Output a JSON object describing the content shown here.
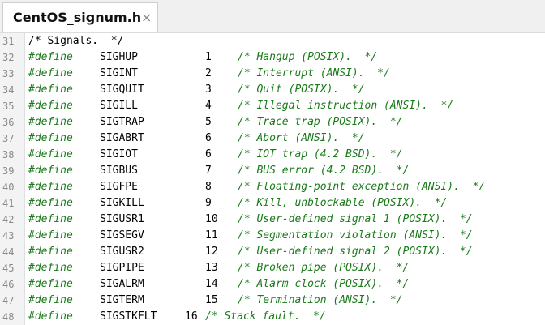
{
  "tab": {
    "title": "CentOS_signum.h",
    "close_glyph": "×"
  },
  "colors": {
    "keyword": "#1a7a1a",
    "comment": "#1a7a1a",
    "text": "#000000",
    "gutter_bg": "#f3f3f3",
    "line_number": "#8a8a8a"
  },
  "header_line": {
    "number": "31",
    "text": "/* Signals.  */"
  },
  "lines": [
    {
      "number": "32",
      "keyword": "#define",
      "name": "SIGHUP",
      "value": "1",
      "comment": "/* Hangup (POSIX).  */"
    },
    {
      "number": "33",
      "keyword": "#define",
      "name": "SIGINT",
      "value": "2",
      "comment": "/* Interrupt (ANSI).  */"
    },
    {
      "number": "34",
      "keyword": "#define",
      "name": "SIGQUIT",
      "value": "3",
      "comment": "/* Quit (POSIX).  */"
    },
    {
      "number": "35",
      "keyword": "#define",
      "name": "SIGILL",
      "value": "4",
      "comment": "/* Illegal instruction (ANSI).  */"
    },
    {
      "number": "36",
      "keyword": "#define",
      "name": "SIGTRAP",
      "value": "5",
      "comment": "/* Trace trap (POSIX).  */"
    },
    {
      "number": "37",
      "keyword": "#define",
      "name": "SIGABRT",
      "value": "6",
      "comment": "/* Abort (ANSI).  */"
    },
    {
      "number": "38",
      "keyword": "#define",
      "name": "SIGIOT",
      "value": "6",
      "comment": "/* IOT trap (4.2 BSD).  */"
    },
    {
      "number": "39",
      "keyword": "#define",
      "name": "SIGBUS",
      "value": "7",
      "comment": "/* BUS error (4.2 BSD).  */"
    },
    {
      "number": "40",
      "keyword": "#define",
      "name": "SIGFPE",
      "value": "8",
      "comment": "/* Floating-point exception (ANSI).  */"
    },
    {
      "number": "41",
      "keyword": "#define",
      "name": "SIGKILL",
      "value": "9",
      "comment": "/* Kill, unblockable (POSIX).  */"
    },
    {
      "number": "42",
      "keyword": "#define",
      "name": "SIGUSR1",
      "value": "10",
      "comment": "/* User-defined signal 1 (POSIX).  */"
    },
    {
      "number": "43",
      "keyword": "#define",
      "name": "SIGSEGV",
      "value": "11",
      "comment": "/* Segmentation violation (ANSI).  */"
    },
    {
      "number": "44",
      "keyword": "#define",
      "name": "SIGUSR2",
      "value": "12",
      "comment": "/* User-defined signal 2 (POSIX).  */"
    },
    {
      "number": "45",
      "keyword": "#define",
      "name": "SIGPIPE",
      "value": "13",
      "comment": "/* Broken pipe (POSIX).  */"
    },
    {
      "number": "46",
      "keyword": "#define",
      "name": "SIGALRM",
      "value": "14",
      "comment": "/* Alarm clock (POSIX).  */"
    },
    {
      "number": "47",
      "keyword": "#define",
      "name": "SIGTERM",
      "value": "15",
      "comment": "/* Termination (ANSI).  */"
    },
    {
      "number": "48",
      "keyword": "#define",
      "name": "SIGSTKFLT",
      "value": "16",
      "comment": "/* Stack fault.  */"
    }
  ]
}
